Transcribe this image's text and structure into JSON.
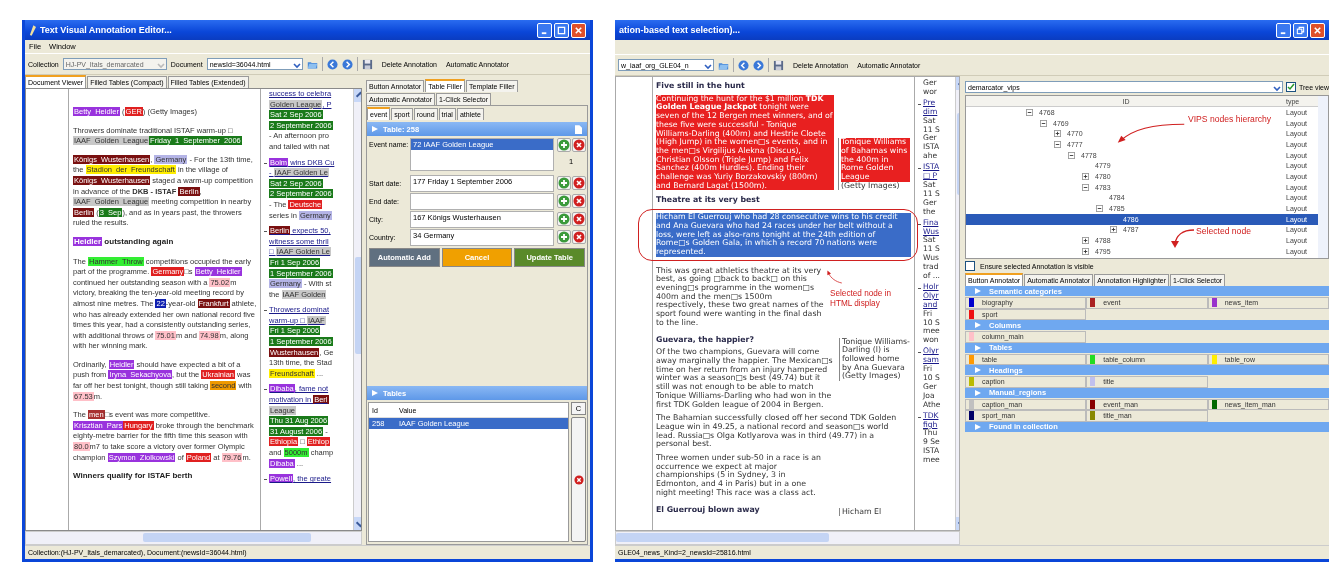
{
  "left_window": {
    "title": "Text Visual Annotation Editor...",
    "menu": [
      "File",
      "Window"
    ],
    "toolbar": {
      "collection_label": "Collection",
      "collection_value": "HJ-PV_Itals_demarcated",
      "document_label": "Document",
      "document_value": "newsId=36044.html",
      "actions": [
        "Delete Annotation",
        "Automatic Annotator"
      ]
    },
    "tabs": [
      {
        "label": "Document Viewer",
        "selected": true
      },
      {
        "label": "Filled Tables (Compact)",
        "selected": false
      },
      {
        "label": "Filled Tables (Extended)",
        "selected": false
      }
    ],
    "document": [
      {
        "kind": "text",
        "segments": [
          {
            "text": "Betty Heidler",
            "color": "#9933dd"
          },
          {
            "text": " ("
          },
          {
            "text": "GER",
            "color": "#e02020"
          },
          {
            "text": ") (Getty Images)"
          }
        ]
      },
      {
        "kind": "text",
        "segments": [
          {
            "text": "Throwers dominate traditional ISTAF warm-up □ "
          },
          {
            "text": "IAAF Golden League",
            "color": "#c8c8c8"
          },
          {
            "text": "Friday 1 September 2006",
            "color": "#1a7a1a"
          }
        ]
      },
      {
        "kind": "text",
        "segments": [
          {
            "text": "Königs Wusterhausen",
            "color": "#7a1010"
          },
          {
            "text": ", "
          },
          {
            "text": "Germany",
            "color": "#b4b4e6"
          },
          {
            "text": " - For the 13th time, the "
          },
          {
            "text": "Stadion der Freundschaft",
            "color": "#ffee00"
          },
          {
            "text": " in the village of "
          },
          {
            "text": "Königs Wusterhausen",
            "color": "#7a1010"
          },
          {
            "text": " staged a warm-up competition in advance of the "
          },
          {
            "text": "**DKB - ISTAF** "
          },
          {
            "text": "Berlin",
            "color": "#7a1010"
          },
          {
            "text": ", "
          },
          {
            "text": "IAAF Golden League",
            "color": "#c8c8c8"
          },
          {
            "text": " meeting competition in nearby "
          },
          {
            "text": "Berlin",
            "color": "#7a1010"
          },
          {
            "text": " ("
          },
          {
            "text": "3 Sep",
            "color": "#1a7a1a"
          },
          {
            "text": "), and as in years past, the throwers ruled the results."
          }
        ]
      },
      {
        "kind": "heading",
        "segments": [
          {
            "text": "Heidler",
            "color": "#9933dd"
          },
          {
            "text": " outstanding again"
          }
        ]
      },
      {
        "kind": "text",
        "segments": [
          {
            "text": "The "
          },
          {
            "text": "Hammer Throw",
            "color": "#33ee33"
          },
          {
            "text": " competitions occupied the early part of the programme. "
          },
          {
            "text": "Germany",
            "color": "#e02020"
          },
          {
            "text": "□s "
          },
          {
            "text": "Betty Heidler",
            "color": "#9933dd"
          },
          {
            "text": " continued her outstanding season with a "
          },
          {
            "text": "75.02",
            "color": "#ffc0c8"
          },
          {
            "text": "m victory, breaking the ten-year-old meeting record by almost nine metres. The "
          },
          {
            "text": "22",
            "color": "#1020b0"
          },
          {
            "text": "-year-old "
          },
          {
            "text": "Frankfurt",
            "color": "#7a1010"
          },
          {
            "text": " athlete, who has already extended her own national record five times this year, had a consistently outstanding series, with additional throws of "
          },
          {
            "text": "75.01",
            "color": "#ffc0c8"
          },
          {
            "text": "m and "
          },
          {
            "text": "74.98",
            "color": "#ffc0c8"
          },
          {
            "text": "m, along with her winning mark."
          }
        ]
      },
      {
        "kind": "text",
        "segments": [
          {
            "text": "Ordinarily, "
          },
          {
            "text": "Heidler",
            "color": "#9933dd"
          },
          {
            "text": " should have expected a bit of a push from "
          },
          {
            "text": "Iryna Sekachyova",
            "color": "#9933dd"
          },
          {
            "text": ", but the "
          },
          {
            "text": "Ukrainian",
            "color": "#e02020"
          },
          {
            "text": " was far off her best tonight, though still taking "
          },
          {
            "text": "second",
            "color": "#ee9900"
          },
          {
            "text": " with "
          },
          {
            "text": "67.53",
            "color": "#ffc0c8"
          },
          {
            "text": "m."
          }
        ]
      },
      {
        "kind": "text",
        "segments": [
          {
            "text": "The "
          },
          {
            "text": "men",
            "color": "#a83030"
          },
          {
            "text": "□s event was more competitive. "
          },
          {
            "text": "Krisztian Pars",
            "color": "#9933dd"
          },
          {
            "text": "Hungary",
            "color": "#e02020"
          },
          {
            "text": " broke through the benchmark eighty-metre barrier for the fifth time this season with "
          },
          {
            "text": "80.0",
            "color": "#ffc0c8"
          },
          {
            "text": "m7 to take score a victory over former Olympic champion "
          },
          {
            "text": "Szymon Ziolkowski",
            "color": "#9933dd"
          },
          {
            "text": " of "
          },
          {
            "text": "Poland",
            "color": "#e02020"
          },
          {
            "text": " at "
          },
          {
            "text": "79.76",
            "color": "#ffc0c8"
          },
          {
            "text": "m."
          }
        ]
      },
      {
        "kind": "heading",
        "segments": [
          {
            "text": "Winners qualify for ISTAF berth"
          }
        ]
      }
    ],
    "news_top": [
      {
        "kind": "link",
        "segments": [
          {
            "text": "success to celebra"
          }
        ]
      },
      {
        "kind": "link",
        "segments": [
          {
            "text": "Golden League",
            "color": "#c8c8c8"
          },
          {
            "text": ", P"
          }
        ]
      },
      {
        "kind": "text",
        "segments": [
          {
            "text": "Sat 2 Sep 2006",
            "color": "#1a7a1a"
          }
        ]
      },
      {
        "kind": "text",
        "segments": [
          {
            "text": "2 September 2006",
            "color": "#1a7a1a"
          }
        ]
      },
      {
        "kind": "text",
        "segments": [
          {
            "text": "- An afternoon pro"
          }
        ]
      },
      {
        "kind": "text",
        "segments": [
          {
            "text": "and tailed with nat"
          }
        ]
      }
    ],
    "news": [
      {
        "lines": [
          {
            "kind": "link",
            "segments": [
              {
                "text": "Bolm",
                "color": "#9933dd"
              },
              {
                "text": " wins DKB Cu"
              }
            ]
          },
          {
            "kind": "link",
            "segments": [
              {
                "text": "- "
              },
              {
                "text": "IAAF Golden Le",
                "color": "#c8c8c8"
              }
            ]
          },
          {
            "kind": "text",
            "segments": [
              {
                "text": "Sat 2 Sep 2006",
                "color": "#1a7a1a"
              }
            ]
          },
          {
            "kind": "text",
            "segments": [
              {
                "text": "2 September 2006",
                "color": "#1a7a1a"
              }
            ]
          },
          {
            "kind": "text",
            "segments": [
              {
                "text": "- The "
              },
              {
                "text": "Deutsche",
                "color": "#e02020"
              }
            ]
          },
          {
            "kind": "text",
            "segments": [
              {
                "text": "series in "
              },
              {
                "text": "Germany",
                "color": "#b4b4e6"
              }
            ]
          }
        ]
      },
      {
        "lines": [
          {
            "kind": "link",
            "segments": [
              {
                "text": "Berlin",
                "color": "#7a1010"
              },
              {
                "text": " expects 50,"
              }
            ]
          },
          {
            "kind": "link",
            "segments": [
              {
                "text": "witness some thril"
              }
            ]
          },
          {
            "kind": "link",
            "segments": [
              {
                "text": "□ "
              },
              {
                "text": "IAAF Golden Le",
                "color": "#c8c8c8"
              }
            ]
          },
          {
            "kind": "text",
            "segments": [
              {
                "text": "Fri 1 Sep 2006",
                "color": "#1a7a1a"
              }
            ]
          },
          {
            "kind": "text",
            "segments": [
              {
                "text": "1 September 2006",
                "color": "#1a7a1a"
              }
            ]
          },
          {
            "kind": "text",
            "segments": [
              {
                "text": "Germany",
                "color": "#b4b4e6"
              },
              {
                "text": " - With st"
              }
            ]
          },
          {
            "kind": "text",
            "segments": [
              {
                "text": "the "
              },
              {
                "text": "IAAF Golden",
                "color": "#c8c8c8"
              }
            ]
          }
        ]
      },
      {
        "lines": [
          {
            "kind": "link",
            "segments": [
              {
                "text": "Throwers dominat"
              }
            ]
          },
          {
            "kind": "link",
            "segments": [
              {
                "text": "warm-up □ "
              },
              {
                "text": "IAAF",
                "color": "#c8c8c8"
              }
            ]
          },
          {
            "kind": "text",
            "segments": [
              {
                "text": "Fri 1 Sep 2006",
                "color": "#1a7a1a"
              }
            ]
          },
          {
            "kind": "text",
            "segments": [
              {
                "text": "1 September 2006",
                "color": "#1a7a1a"
              }
            ]
          },
          {
            "kind": "text",
            "segments": [
              {
                "text": "Wusterhausen",
                "color": "#7a1010"
              },
              {
                "text": ", Ge"
              }
            ]
          },
          {
            "kind": "text",
            "segments": [
              {
                "text": "13th time, the Stad"
              }
            ]
          },
          {
            "kind": "text",
            "segments": [
              {
                "text": "Freundschaft",
                "color": "#ffee00"
              },
              {
                "text": " ..."
              }
            ]
          }
        ]
      },
      {
        "lines": [
          {
            "kind": "link",
            "segments": [
              {
                "text": "Dibaba",
                "color": "#9933dd"
              },
              {
                "text": ", fame not"
              }
            ]
          },
          {
            "kind": "link",
            "segments": [
              {
                "text": "motivation in "
              },
              {
                "text": "Berl",
                "color": "#7a1010"
              }
            ]
          },
          {
            "kind": "text",
            "segments": [
              {
                "text": "League",
                "color": "#c8c8c8"
              }
            ]
          },
          {
            "kind": "text",
            "segments": [
              {
                "text": "Thu 31 Aug 2006",
                "color": "#1a7a1a"
              }
            ]
          },
          {
            "kind": "text",
            "segments": [
              {
                "text": "31 August 2006",
                "color": "#1a7a1a"
              },
              {
                "text": " -"
              }
            ]
          },
          {
            "kind": "text",
            "segments": [
              {
                "text": "Ethiopia",
                "color": "#e02020"
              },
              {
                "text": " □ "
              },
              {
                "text": "Ethiop",
                "color": "#e02020"
              }
            ]
          },
          {
            "kind": "text",
            "segments": [
              {
                "text": "and "
              },
              {
                "text": "5000m",
                "color": "#33ee33"
              },
              {
                "text": " champ"
              }
            ]
          },
          {
            "kind": "text",
            "segments": [
              {
                "text": "Dibaba",
                "color": "#9933dd"
              },
              {
                "text": " ..."
              }
            ]
          }
        ]
      },
      {
        "lines": [
          {
            "kind": "link",
            "segments": [
              {
                "text": "Powell",
                "color": "#9933dd"
              },
              {
                "text": ", the greate"
              }
            ]
          }
        ]
      }
    ],
    "side_tabs": [
      {
        "label": "Button Annotator",
        "selected": false
      },
      {
        "label": "Table Filler",
        "selected": true
      },
      {
        "label": "Template Filler",
        "selected": false
      },
      {
        "label": "Automatic Annotator",
        "selected": false
      },
      {
        "label": "1-Click Selector",
        "selected": false
      }
    ],
    "sub_tabs": [
      {
        "label": "event",
        "selected": true
      },
      {
        "label": "sport",
        "selected": false
      },
      {
        "label": "round",
        "selected": false
      },
      {
        "label": "trial",
        "selected": false
      },
      {
        "label": "athlete",
        "selected": false
      }
    ],
    "table_header": "Table: 258",
    "fields": [
      {
        "label": "Event name:",
        "value": "72 IAAF Golden League",
        "selected": true,
        "count": "1"
      },
      {
        "label": "Start date:",
        "value": "177 Friday 1 September 2006",
        "selected": false
      },
      {
        "label": "End date:",
        "selected": false
      },
      {
        "label": "City:",
        "value": "167 Königs Wusterhausen",
        "selected": false
      },
      {
        "label": "Country:",
        "value": "34 Germany",
        "selected": false
      }
    ],
    "buttons": [
      {
        "label": "Automatic Add",
        "kind": "neutral"
      },
      {
        "label": "Cancel",
        "kind": "cancel"
      },
      {
        "label": "Update Table",
        "kind": "confirm"
      }
    ],
    "tables": {
      "title": "Tables",
      "columns": [
        "Id",
        "Value"
      ],
      "rows": [
        {
          "cells": [
            "258",
            "IAAF Golden League"
          ],
          "selected": true
        }
      ],
      "side_button": "C"
    },
    "status_bar": "Collection:(HJ-PV_Itals_demarcated), Document:(newsId=36044.html)"
  },
  "right_window": {
    "title": "ation-based text selection)...",
    "toolbar": {
      "document_value": "w_iaaf_org_GLE04_n",
      "actions": [
        "Delete Annotation",
        "Automatic Annotator"
      ]
    },
    "document": [
      {
        "kind": "heading",
        "selected": false,
        "segments": [
          {
            "text": "Five still in the hunt"
          }
        ]
      },
      {
        "kind": "text",
        "selected": false,
        "segments": [
          {
            "text": "Continuing the hunt for the $1 million **TDK Golden League Jackpot** tonight were seven of the 12 Bergen meet winners, and of these five were successful - Tonique Williams-Darling (400m) and Hestrie Cloete (High Jump) in the women□s events, and in the men□s Virgilijus Alekna (Discus), Christian Olsson (Triple Jump) and Felix Sanchez (400m Hurdles). Ending their challenge was Yuriy Borzakovskiy (800m) and Bernard Lagat (1500m).",
            "color": "#e82020"
          }
        ],
        "caption": [
          {
            "text": "Tonique Williams of Bahamas wins the 400m in Rome Golden League",
            "color": "#e82020"
          },
          {
            "text": "(Getty Images)"
          }
        ]
      },
      {
        "kind": "heading",
        "selected": false,
        "segments": [
          {
            "text": "Theatre at its very best"
          }
        ]
      },
      {
        "kind": "text",
        "selected": true,
        "segments": [
          {
            "text": "Hicham El Guerrouj who had 28 consecutive wins to his credit and Ana Guevara who had 24 races under her belt without a loss, were left as also-rans tonight at the 24th edition of Rome□s Golden Gala, in which a record 70 nations were represented."
          }
        ]
      },
      {
        "kind": "text",
        "selected": false,
        "segments": [
          {
            "text": "This was great athletics theatre at its very best, as going □back to back□ on this evening□s programme in the women□s 400m and the men□s 1500m respectively, these two great names of the sport found were wanting in the final dash to the line."
          }
        ]
      },
      {
        "kind": "heading",
        "selected": false,
        "segments": [
          {
            "text": "Guevara, the happier?"
          }
        ]
      },
      {
        "kind": "caption",
        "selected": false,
        "segments": [
          {
            "text": "Tonique Williams-Darling (l) is followed home by Ana Guevara (Getty Images)"
          }
        ]
      },
      {
        "kind": "text",
        "selected": false,
        "segments": [
          {
            "text": "Of the two champions, Guevara will come away marginally the happier. The Mexican□s time on her return from an injury hampered winter was a season□s best (49.74) but it still was not enough to be able to match Tonique Williams-Darling who had won in the first TDK Golden league of 2004 in Bergen."
          }
        ]
      },
      {
        "kind": "text",
        "selected": false,
        "segments": [
          {
            "text": "The Bahamian successfully closed off her second TDK Golden League win in 49.25, a national record and season□s world lead. Russia□s Olga Kotlyarova was in third (49.77) in a personal best."
          }
        ]
      },
      {
        "kind": "text",
        "selected": false,
        "segments": [
          {
            "text": "Three women under sub-50 in a race is an occurrence we expect at major championships (5 in Sydney, 3 in Edmonton, and 4 in Paris) but in a one night meeting! This race was a class act."
          }
        ]
      },
      {
        "kind": "heading",
        "selected": false,
        "segments": [
          {
            "text": "El Guerrouj blown away"
          }
        ]
      },
      {
        "kind": "caption",
        "selected": false,
        "segments": [
          {
            "text": "Hicham El"
          }
        ]
      }
    ],
    "news_top": [
      "Ger",
      "wor"
    ],
    "news": [
      {
        "headline": [
          "Pre",
          "dim"
        ],
        "body": [
          "Sat",
          "11 S",
          "Ger",
          "ISTA",
          "ahe"
        ]
      },
      {
        "headline": [
          "ISTA",
          "□ P"
        ],
        "body": [
          "Sat",
          "11 S",
          "Ger",
          "the"
        ]
      },
      {
        "headline": [
          "Fina",
          "Wus"
        ],
        "body": [
          "Sat",
          "11 S",
          "Wus",
          "trad",
          "of ..."
        ]
      },
      {
        "headline": [
          "Holr",
          "Olyr",
          "and"
        ],
        "body": [
          "Fri",
          "10 S",
          "mee",
          "won"
        ]
      },
      {
        "headline": [
          "Olyr",
          "sam"
        ],
        "body": [
          "Fri",
          "10 S",
          "Ger",
          "Joa",
          "Athe"
        ]
      },
      {
        "headline": [
          "TDK",
          "figh"
        ],
        "body": [
          "Thu",
          "9 Se",
          "ISTA",
          "mee"
        ]
      }
    ],
    "annotations": [
      "Selected node in HTML display",
      "VIPS nodes hierarchy",
      "Selected node"
    ],
    "segmenter": "demarcator_vips",
    "tree_view": {
      "label": "Tree view",
      "checked": true
    },
    "tree_columns": [
      "ID",
      "type"
    ],
    "tree": [
      {
        "id": "4768",
        "type": "Layout",
        "expanded": true,
        "selected": false,
        "children": [
          {
            "id": "4769",
            "type": "Layout",
            "expanded": true,
            "selected": false,
            "children": [
              {
                "id": "4770",
                "type": "Layout",
                "expanded": false,
                "selected": false
              },
              {
                "id": "4777",
                "type": "Layout",
                "expanded": true,
                "selected": false,
                "children": [
                  {
                    "id": "4778",
                    "type": "Layout",
                    "expanded": true,
                    "selected": false,
                    "children": [
                      {
                        "id": "4779",
                        "type": "Layout",
                        "selected": false
                      },
                      {
                        "id": "4780",
                        "type": "Layout",
                        "expanded": false,
                        "selected": false
                      },
                      {
                        "id": "4783",
                        "type": "Layout",
                        "expanded": true,
                        "selected": false,
                        "children": [
                          {
                            "id": "4784",
                            "type": "Layout",
                            "selected": false
                          },
                          {
                            "id": "4785",
                            "type": "Layout",
                            "expanded": true,
                            "selected": false,
                            "children": [
                              {
                                "id": "4786",
                                "type": "Layout",
                                "selected": true
                              },
                              {
                                "id": "4787",
                                "type": "Layout",
                                "expanded": false,
                                "selected": false
                              }
                            ]
                          }
                        ]
                      },
                      {
                        "id": "4788",
                        "type": "Layout",
                        "expanded": false,
                        "selected": false
                      },
                      {
                        "id": "4795",
                        "type": "Layout",
                        "expanded": false,
                        "selected": false
                      }
                    ]
                  }
                ]
              }
            ]
          }
        ]
      }
    ],
    "ensure_visible": {
      "label": "Ensure selected Annotation is visible",
      "checked": false
    },
    "tabs": [
      {
        "label": "Button Annotator",
        "selected": true
      },
      {
        "label": "Automatic Annotator",
        "selected": false
      },
      {
        "label": "Annotation Highlighter",
        "selected": false
      },
      {
        "label": "1-Click Selector",
        "selected": false
      }
    ],
    "sections": [
      {
        "title": "Semantic categories",
        "items": [
          {
            "label": "biography",
            "color": "#0000cc"
          },
          {
            "label": "event",
            "color": "#aa2222"
          },
          {
            "label": "news_item",
            "color": "#9933cc"
          },
          {
            "label": "sport",
            "color": "#ee1111"
          }
        ]
      },
      {
        "title": "Columns",
        "items": [
          {
            "label": "column_main",
            "color": "#ffc0c8"
          }
        ]
      },
      {
        "title": "Tables",
        "items": [
          {
            "label": "table",
            "color": "#ff9900"
          },
          {
            "label": "table_column",
            "color": "#22dd22"
          },
          {
            "label": "table_row",
            "color": "#ffee00"
          }
        ]
      },
      {
        "title": "Headings",
        "items": [
          {
            "label": "caption",
            "color": "#bbbb00"
          },
          {
            "label": "title",
            "color": "#c0c0ee"
          }
        ]
      },
      {
        "title": "Manual_regions",
        "items": [
          {
            "label": "caption_man",
            "color": "#c0c0c0"
          },
          {
            "label": "event_man",
            "color": "#880000"
          },
          {
            "label": "news_item_man",
            "color": "#006600"
          },
          {
            "label": "sport_man",
            "color": "#000066"
          },
          {
            "label": "title_man",
            "color": "#888800"
          }
        ]
      },
      {
        "title": "Found in collection"
      }
    ],
    "status_bar": "GLE04_news_Kind=2_newsId=25816.html"
  }
}
